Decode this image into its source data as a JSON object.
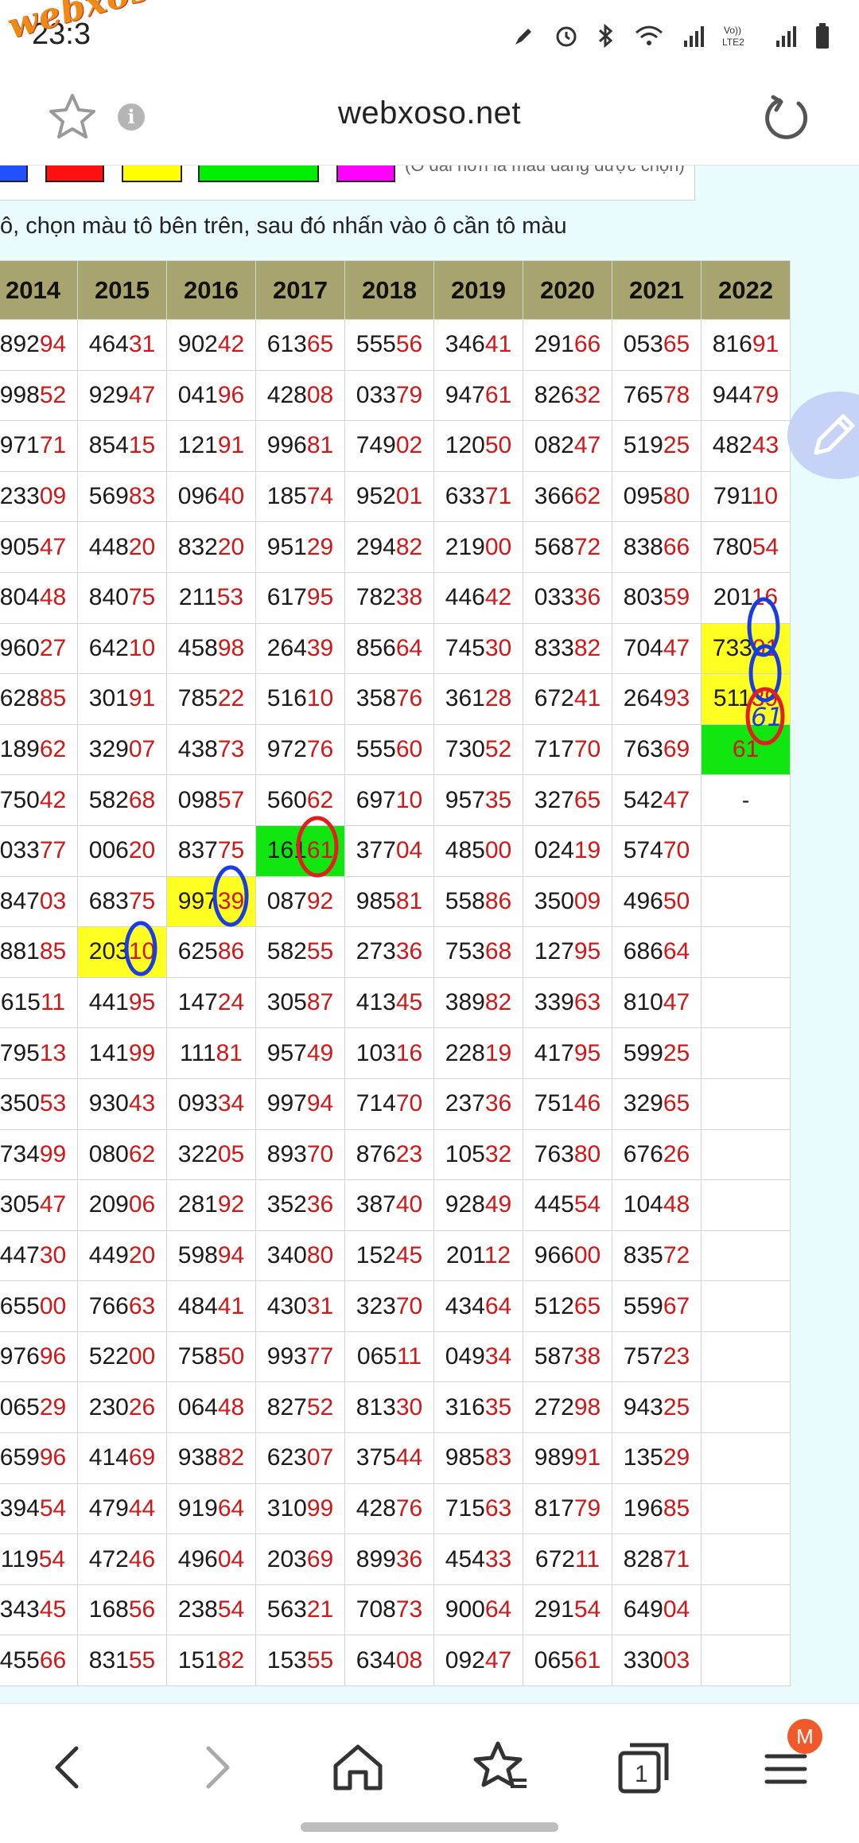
{
  "status_bar": {
    "time": "23:3",
    "watermark": "webxoso.net"
  },
  "browser": {
    "url": "webxoso.net",
    "tabs_count": "1",
    "profile_badge": "M"
  },
  "palette": {
    "swatches": [
      "#2050ff",
      "#ff1010",
      "#ffff00",
      "#00ee00",
      "#ff00ff"
    ],
    "note": "(Ô dài hơn là màu đang được chọn)"
  },
  "instruction": "ô, chọn màu tô bên trên, sau đó nhấn vào ô cần tô màu",
  "table": {
    "years": [
      "2014",
      "2015",
      "2016",
      "2017",
      "2018",
      "2019",
      "2020",
      "2021",
      "2022"
    ],
    "rows": [
      [
        [
          "892",
          "94"
        ],
        [
          "464",
          "31"
        ],
        [
          "902",
          "42"
        ],
        [
          "613",
          "65"
        ],
        [
          "555",
          "56"
        ],
        [
          "346",
          "41"
        ],
        [
          "291",
          "66"
        ],
        [
          "053",
          "65"
        ],
        [
          "816",
          "91"
        ]
      ],
      [
        [
          "998",
          "52"
        ],
        [
          "929",
          "47"
        ],
        [
          "041",
          "96"
        ],
        [
          "428",
          "08"
        ],
        [
          "033",
          "79"
        ],
        [
          "947",
          "61"
        ],
        [
          "826",
          "32"
        ],
        [
          "765",
          "78"
        ],
        [
          "944",
          "79"
        ]
      ],
      [
        [
          "971",
          "71"
        ],
        [
          "854",
          "15"
        ],
        [
          "121",
          "91"
        ],
        [
          "996",
          "81"
        ],
        [
          "749",
          "02"
        ],
        [
          "120",
          "50"
        ],
        [
          "082",
          "47"
        ],
        [
          "519",
          "25"
        ],
        [
          "482",
          "43"
        ]
      ],
      [
        [
          "233",
          "09"
        ],
        [
          "569",
          "83"
        ],
        [
          "096",
          "40"
        ],
        [
          "185",
          "74"
        ],
        [
          "952",
          "01"
        ],
        [
          "633",
          "71"
        ],
        [
          "366",
          "62"
        ],
        [
          "095",
          "80"
        ],
        [
          "791",
          "10"
        ]
      ],
      [
        [
          "905",
          "47"
        ],
        [
          "448",
          "20"
        ],
        [
          "832",
          "20"
        ],
        [
          "951",
          "29"
        ],
        [
          "294",
          "82"
        ],
        [
          "219",
          "00"
        ],
        [
          "568",
          "72"
        ],
        [
          "838",
          "66"
        ],
        [
          "780",
          "54"
        ]
      ],
      [
        [
          "804",
          "48"
        ],
        [
          "840",
          "75"
        ],
        [
          "211",
          "53"
        ],
        [
          "617",
          "95"
        ],
        [
          "782",
          "38"
        ],
        [
          "446",
          "42"
        ],
        [
          "033",
          "36"
        ],
        [
          "803",
          "59"
        ],
        [
          "201",
          "16"
        ]
      ],
      [
        [
          "960",
          "27"
        ],
        [
          "642",
          "10"
        ],
        [
          "458",
          "98"
        ],
        [
          "264",
          "39"
        ],
        [
          "856",
          "64"
        ],
        [
          "745",
          "30"
        ],
        [
          "833",
          "82"
        ],
        [
          "704",
          "47"
        ],
        [
          "733",
          "01"
        ]
      ],
      [
        [
          "628",
          "85"
        ],
        [
          "301",
          "91"
        ],
        [
          "785",
          "22"
        ],
        [
          "516",
          "10"
        ],
        [
          "358",
          "76"
        ],
        [
          "361",
          "28"
        ],
        [
          "672",
          "41"
        ],
        [
          "264",
          "93"
        ],
        [
          "511",
          "39"
        ]
      ],
      [
        [
          "189",
          "62"
        ],
        [
          "329",
          "07"
        ],
        [
          "438",
          "73"
        ],
        [
          "972",
          "76"
        ],
        [
          "555",
          "60"
        ],
        [
          "730",
          "52"
        ],
        [
          "717",
          "70"
        ],
        [
          "763",
          "69"
        ],
        [
          "",
          "61"
        ]
      ],
      [
        [
          "750",
          "42"
        ],
        [
          "582",
          "68"
        ],
        [
          "098",
          "57"
        ],
        [
          "560",
          "62"
        ],
        [
          "697",
          "10"
        ],
        [
          "957",
          "35"
        ],
        [
          "327",
          "65"
        ],
        [
          "542",
          "47"
        ],
        [
          "-",
          ""
        ]
      ],
      [
        [
          "033",
          "77"
        ],
        [
          "006",
          "20"
        ],
        [
          "837",
          "75"
        ],
        [
          "161",
          "61"
        ],
        [
          "377",
          "04"
        ],
        [
          "485",
          "00"
        ],
        [
          "024",
          "19"
        ],
        [
          "574",
          "70"
        ],
        [
          "",
          ""
        ]
      ],
      [
        [
          "847",
          "03"
        ],
        [
          "683",
          "75"
        ],
        [
          "997",
          "39"
        ],
        [
          "087",
          "92"
        ],
        [
          "985",
          "81"
        ],
        [
          "558",
          "86"
        ],
        [
          "350",
          "09"
        ],
        [
          "496",
          "50"
        ],
        [
          "",
          ""
        ]
      ],
      [
        [
          "881",
          "85"
        ],
        [
          "203",
          "10"
        ],
        [
          "625",
          "86"
        ],
        [
          "582",
          "55"
        ],
        [
          "273",
          "36"
        ],
        [
          "753",
          "68"
        ],
        [
          "127",
          "95"
        ],
        [
          "686",
          "64"
        ],
        [
          "",
          ""
        ]
      ],
      [
        [
          "615",
          "11"
        ],
        [
          "441",
          "95"
        ],
        [
          "147",
          "24"
        ],
        [
          "305",
          "87"
        ],
        [
          "413",
          "45"
        ],
        [
          "389",
          "82"
        ],
        [
          "339",
          "63"
        ],
        [
          "810",
          "47"
        ],
        [
          "",
          ""
        ]
      ],
      [
        [
          "795",
          "13"
        ],
        [
          "141",
          "99"
        ],
        [
          "111",
          "81"
        ],
        [
          "957",
          "49"
        ],
        [
          "103",
          "16"
        ],
        [
          "228",
          "19"
        ],
        [
          "417",
          "95"
        ],
        [
          "599",
          "25"
        ],
        [
          "",
          ""
        ]
      ],
      [
        [
          "350",
          "53"
        ],
        [
          "930",
          "43"
        ],
        [
          "093",
          "34"
        ],
        [
          "997",
          "94"
        ],
        [
          "714",
          "70"
        ],
        [
          "237",
          "36"
        ],
        [
          "751",
          "46"
        ],
        [
          "329",
          "65"
        ],
        [
          "",
          ""
        ]
      ],
      [
        [
          "734",
          "99"
        ],
        [
          "080",
          "62"
        ],
        [
          "322",
          "05"
        ],
        [
          "893",
          "70"
        ],
        [
          "876",
          "23"
        ],
        [
          "105",
          "32"
        ],
        [
          "763",
          "80"
        ],
        [
          "676",
          "26"
        ],
        [
          "",
          ""
        ]
      ],
      [
        [
          "305",
          "47"
        ],
        [
          "209",
          "06"
        ],
        [
          "281",
          "92"
        ],
        [
          "352",
          "36"
        ],
        [
          "387",
          "40"
        ],
        [
          "928",
          "49"
        ],
        [
          "445",
          "54"
        ],
        [
          "104",
          "48"
        ],
        [
          "",
          ""
        ]
      ],
      [
        [
          "447",
          "30"
        ],
        [
          "449",
          "20"
        ],
        [
          "598",
          "94"
        ],
        [
          "340",
          "80"
        ],
        [
          "152",
          "45"
        ],
        [
          "201",
          "12"
        ],
        [
          "966",
          "00"
        ],
        [
          "835",
          "72"
        ],
        [
          "",
          ""
        ]
      ],
      [
        [
          "655",
          "00"
        ],
        [
          "766",
          "63"
        ],
        [
          "484",
          "41"
        ],
        [
          "430",
          "31"
        ],
        [
          "323",
          "70"
        ],
        [
          "434",
          "64"
        ],
        [
          "512",
          "65"
        ],
        [
          "559",
          "67"
        ],
        [
          "",
          ""
        ]
      ],
      [
        [
          "976",
          "96"
        ],
        [
          "522",
          "00"
        ],
        [
          "758",
          "50"
        ],
        [
          "993",
          "77"
        ],
        [
          "065",
          "11"
        ],
        [
          "049",
          "34"
        ],
        [
          "587",
          "38"
        ],
        [
          "757",
          "23"
        ],
        [
          "",
          ""
        ]
      ],
      [
        [
          "065",
          "29"
        ],
        [
          "230",
          "26"
        ],
        [
          "064",
          "48"
        ],
        [
          "827",
          "52"
        ],
        [
          "813",
          "30"
        ],
        [
          "316",
          "35"
        ],
        [
          "272",
          "98"
        ],
        [
          "943",
          "25"
        ],
        [
          "",
          ""
        ]
      ],
      [
        [
          "659",
          "96"
        ],
        [
          "414",
          "69"
        ],
        [
          "938",
          "82"
        ],
        [
          "623",
          "07"
        ],
        [
          "375",
          "44"
        ],
        [
          "985",
          "83"
        ],
        [
          "989",
          "91"
        ],
        [
          "135",
          "29"
        ],
        [
          "",
          ""
        ]
      ],
      [
        [
          "394",
          "54"
        ],
        [
          "479",
          "44"
        ],
        [
          "919",
          "64"
        ],
        [
          "310",
          "99"
        ],
        [
          "428",
          "76"
        ],
        [
          "715",
          "63"
        ],
        [
          "817",
          "79"
        ],
        [
          "196",
          "85"
        ],
        [
          "",
          ""
        ]
      ],
      [
        [
          "119",
          "54"
        ],
        [
          "472",
          "46"
        ],
        [
          "496",
          "04"
        ],
        [
          "203",
          "69"
        ],
        [
          "899",
          "36"
        ],
        [
          "454",
          "33"
        ],
        [
          "672",
          "11"
        ],
        [
          "828",
          "71"
        ],
        [
          "",
          ""
        ]
      ],
      [
        [
          "343",
          "45"
        ],
        [
          "168",
          "56"
        ],
        [
          "238",
          "54"
        ],
        [
          "563",
          "21"
        ],
        [
          "708",
          "73"
        ],
        [
          "900",
          "64"
        ],
        [
          "291",
          "54"
        ],
        [
          "649",
          "04"
        ],
        [
          "",
          ""
        ]
      ],
      [
        [
          "455",
          "66"
        ],
        [
          "831",
          "55"
        ],
        [
          "151",
          "82"
        ],
        [
          "153",
          "55"
        ],
        [
          "634",
          "08"
        ],
        [
          "092",
          "47"
        ],
        [
          "065",
          "61"
        ],
        [
          "330",
          "03"
        ],
        [
          "",
          ""
        ]
      ]
    ],
    "highlights": [
      {
        "row": 6,
        "col": 8,
        "color": "yellow"
      },
      {
        "row": 7,
        "col": 8,
        "color": "yellow"
      },
      {
        "row": 8,
        "col": 8,
        "color": "green"
      },
      {
        "row": 10,
        "col": 3,
        "color": "green"
      },
      {
        "row": 11,
        "col": 2,
        "color": "yellow"
      },
      {
        "row": 12,
        "col": 1,
        "color": "yellow"
      }
    ]
  },
  "icons": {
    "favorite": "star-outline-icon",
    "info": "info-icon",
    "reload": "reload-icon",
    "pen": "pen-icon",
    "back": "back-icon",
    "forward": "forward-icon",
    "home": "home-icon",
    "bookmarks": "bookmark-star-icon",
    "tabs": "tabs-icon",
    "menu": "menu-icon"
  }
}
